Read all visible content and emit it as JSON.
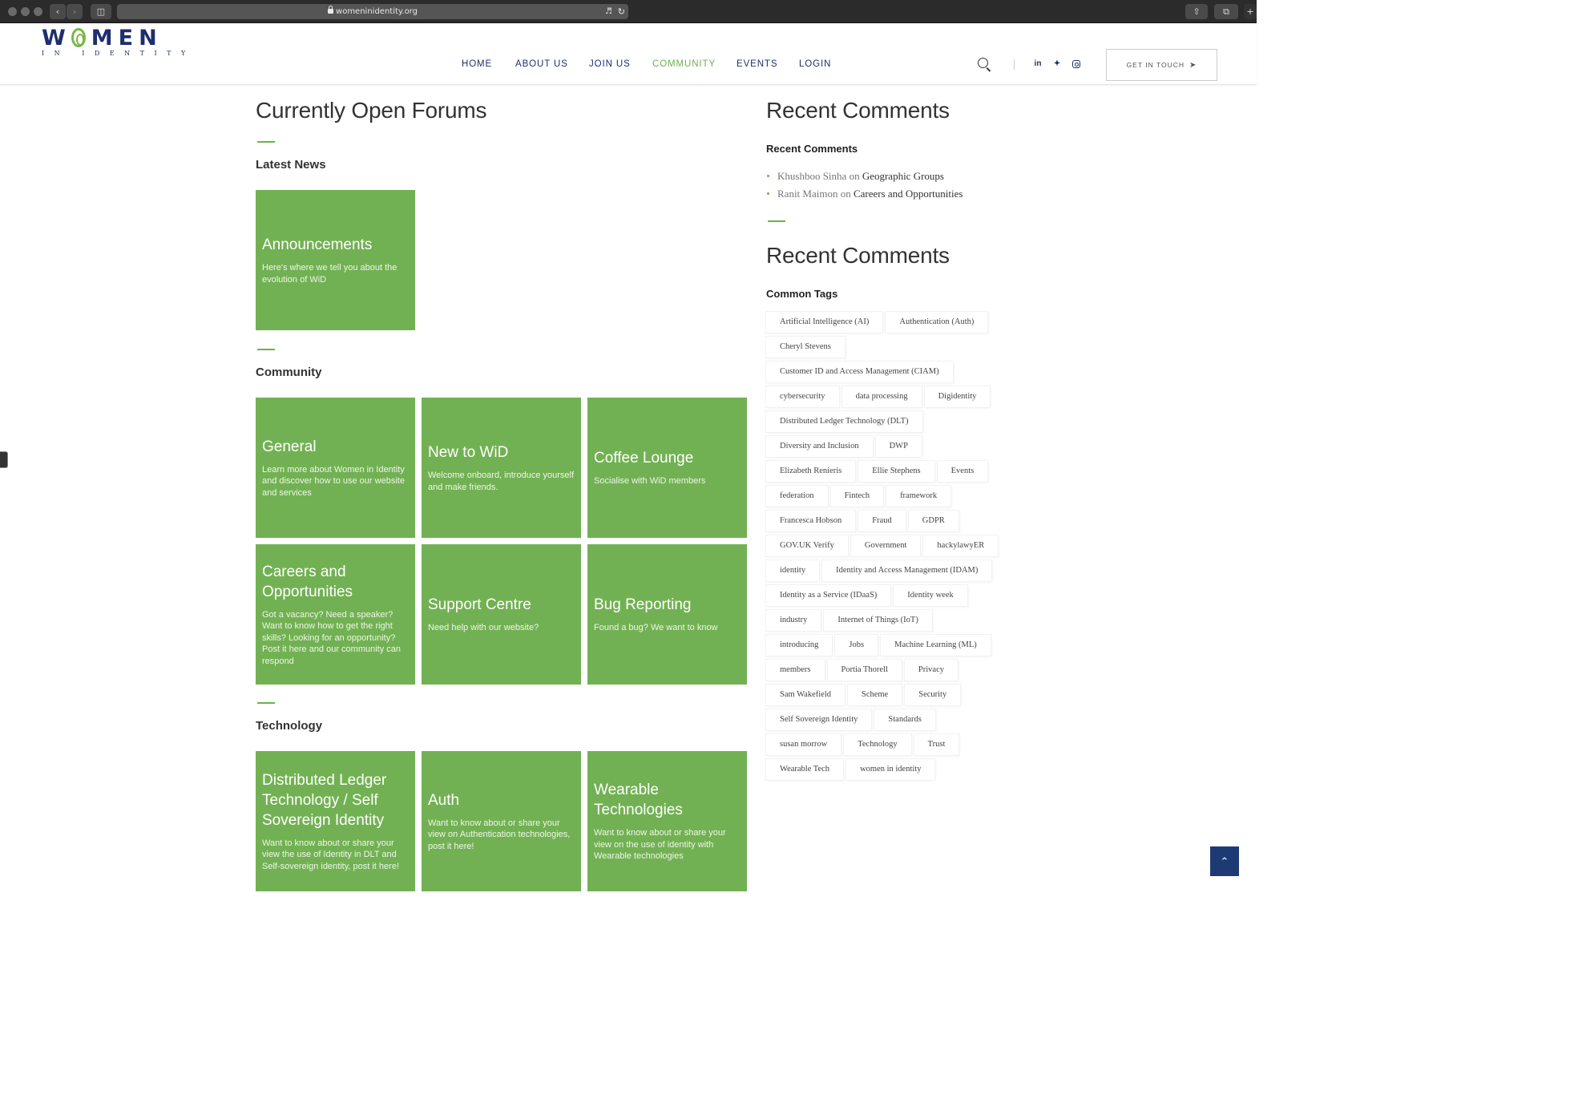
{
  "browser": {
    "url": "womeninidentity.org"
  },
  "logo": {
    "top": "WOMEN",
    "bottom": "IN IDENTITY"
  },
  "nav": {
    "items": [
      {
        "label": "HOME"
      },
      {
        "label": "ABOUT US"
      },
      {
        "label": "JOIN US"
      },
      {
        "label": "COMMUNITY"
      },
      {
        "label": "EVENTS"
      },
      {
        "label": "LOGIN"
      }
    ],
    "active": "COMMUNITY",
    "cta_label": "GET IN TOUCH",
    "social": [
      "in",
      "twitter",
      "instagram"
    ]
  },
  "main": {
    "title": "Currently Open Forums",
    "sections": [
      {
        "title": "Latest News",
        "forums": [
          {
            "title": "Announcements",
            "desc": "Here's where we tell you about the evolution of WiD"
          }
        ]
      },
      {
        "title": "Community",
        "forums": [
          {
            "title": "General",
            "desc": "Learn more about Women in Identity and discover how to use our website and services"
          },
          {
            "title": "New to WiD",
            "desc": "Welcome onboard, introduce yourself and make friends."
          },
          {
            "title": "Coffee Lounge",
            "desc": "Socialise with WiD members"
          },
          {
            "title": "Careers and Opportunities",
            "desc": "Got a vacancy? Need a speaker? Want to know how to get the right skills?  Looking for an opportunity? Post it here and our community can respond"
          },
          {
            "title": "Support Centre",
            "desc": "Need help with our website?"
          },
          {
            "title": "Bug Reporting",
            "desc": "Found a bug? We want to know"
          }
        ]
      },
      {
        "title": "Technology",
        "forums": [
          {
            "title": "Distributed Ledger Technology / Self Sovereign Identity",
            "desc": "Want to know about or share your view the use of Identity in DLT and Self-sovereign identity, post it here!"
          },
          {
            "title": "Auth",
            "desc": "Want to know about or share your view on Authentication technologies, post it here!"
          },
          {
            "title": "Wearable Technologies",
            "desc": "Want to know about or share your view on the use of identity with Wearable technologies"
          }
        ]
      }
    ]
  },
  "sidebar": {
    "recent_comments_heading": "Recent Comments",
    "recent_comments_subheading": "Recent Comments",
    "comments": [
      {
        "author": "Khushboo Sinha",
        "on": "on",
        "topic": "Geographic Groups"
      },
      {
        "author": "Ranit Maimon",
        "on": "on",
        "topic": "Careers and Opportunities"
      }
    ],
    "tags_heading": "Recent Comments",
    "tags_subheading": "Common Tags",
    "tag_rows": [
      [
        "Artificial Intelligence (AI)",
        "Authentication (Auth)"
      ],
      [
        "Cheryl Stevens"
      ],
      [
        "Customer ID and Access Management (CIAM)"
      ],
      [
        "cybersecurity",
        "data processing",
        "Digidentity"
      ],
      [
        "Distributed Ledger Technology (DLT)"
      ],
      [
        "Diversity and Inclusion",
        "DWP"
      ],
      [
        "Elizabeth Renieris",
        "Ellie Stephens",
        "Events"
      ],
      [
        "federation",
        "Fintech",
        "framework"
      ],
      [
        "Francesca Hobson",
        "Fraud",
        "GDPR"
      ],
      [
        "GOV.UK Verify",
        "Government",
        "hackylawyER"
      ],
      [
        "identity",
        "Identity and Access Management (IDAM)"
      ],
      [
        "Identity as a Service (IDaaS)",
        "Identity week"
      ],
      [
        "industry",
        "Internet of Things (IoT)"
      ],
      [
        "introducing",
        "Jobs",
        "Machine Learning (ML)"
      ],
      [
        "members",
        "Portia Thorell",
        "Privacy"
      ],
      [
        "Sam Wakefield",
        "Scheme",
        "Security"
      ],
      [
        "Self Sovereign Identity",
        "Standards"
      ],
      [
        "susan morrow",
        "Technology",
        "Trust"
      ],
      [
        "Wearable Tech",
        "women in identity"
      ]
    ]
  },
  "colors": {
    "tile_green": "#72b153",
    "accent_green": "#6cb14c",
    "navy": "#1c2f6e"
  }
}
